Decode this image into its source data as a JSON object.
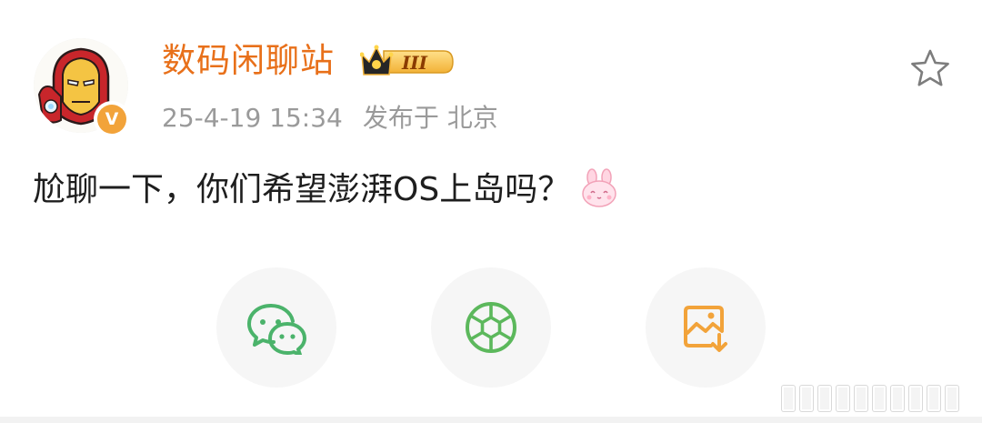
{
  "post": {
    "author": {
      "name": "数码闲聊站",
      "avatar_icon": "ironman-avatar",
      "verified_icon": "verified-v-badge",
      "verified_letter": "V",
      "vip_icon": "crown-vip-badge",
      "vip_level": "III"
    },
    "timestamp": "25-4-19 15:34",
    "location_prefix": "发布于",
    "location": "北京",
    "text": "尬聊一下，你们希望澎湃OS上岛吗？",
    "emoji_icon": "bunny-emoji"
  },
  "actions": {
    "favorite_icon": "star-icon"
  },
  "share": [
    {
      "icon": "wechat-icon",
      "color": "#4bb36b"
    },
    {
      "icon": "moments-icon",
      "color": "#5cb85c"
    },
    {
      "icon": "save-image-icon",
      "color": "#f2a33a"
    }
  ],
  "colors": {
    "author_name": "#e8701a",
    "meta_text": "#9a9a9a",
    "body_text": "#1e1e1e",
    "share_bg": "#f6f6f6"
  }
}
